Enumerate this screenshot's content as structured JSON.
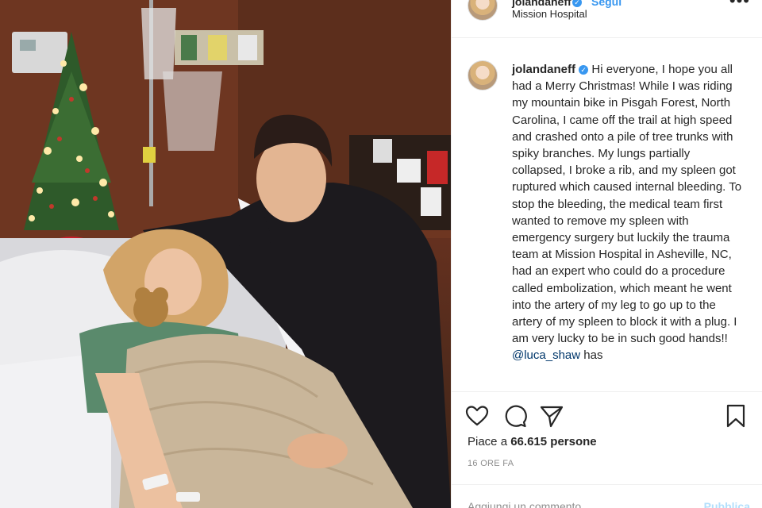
{
  "post": {
    "username": "jolandaneff",
    "follow_label": "Segui",
    "location": "Mission Hospital",
    "more_label": "•••"
  },
  "caption": {
    "text": "Hi everyone, I hope you all had a Merry Christmas! While I was riding my mountain bike in Pisgah Forest, North Carolina, I came off the trail at high speed and crashed onto a pile of tree trunks with spiky branches. My lungs partially collapsed, I broke a rib, and my spleen got ruptured which caused internal bleeding. To stop the bleeding, the medical team first wanted to remove my spleen with emergency surgery but luckily the trauma team at Mission Hospital in Asheville, NC, had an expert who could do a procedure called embolization, which meant he went into the artery of my leg to go up to the artery of my spleen to block it with a plug. I am very lucky to be in such good hands!!",
    "mention": "@luca_shaw",
    "tail": "has"
  },
  "actions": {
    "like_icon": "heart-icon",
    "comment_icon": "comment-icon",
    "share_icon": "share-icon",
    "save_icon": "bookmark-icon"
  },
  "likes": {
    "prefix": "Piace a",
    "count": "66.615",
    "suffix": "persone"
  },
  "timestamp": "16 ORE FA",
  "comment": {
    "placeholder": "Aggiungi un commento...",
    "publish_label": "Pubblica"
  },
  "colors": {
    "accent": "#3897f0",
    "text": "#262626",
    "muted": "#8e8e8e",
    "border": "#efefef"
  }
}
